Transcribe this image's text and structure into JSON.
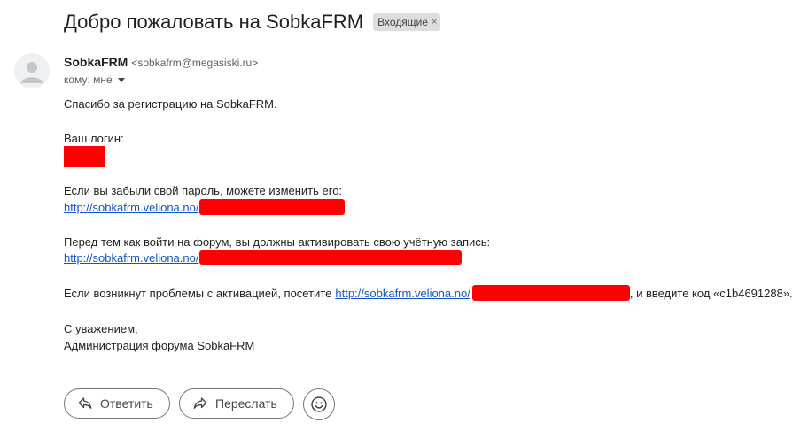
{
  "header": {
    "subject": "Добро пожаловать на SobkaFRM",
    "label": "Входящие",
    "label_remove": "×"
  },
  "sender": {
    "name": "SobkaFRM",
    "email": "<sobkafrm@megasiski.ru>",
    "to": "кому: мне"
  },
  "message": {
    "thanks": "Спасибо за регистрацию на SobkaFRM.",
    "login_label": "Ваш логин:",
    "forgot_text": "Если вы забыли свой пароль, можете изменить его:",
    "forgot_link": "http://sobkafrm.veliona.no/",
    "activate_text": "Перед тем как войти на форум, вы должны активировать свою учётную запись:",
    "activate_link": "http://sobkafrm.veliona.no/",
    "problems_text": "Если возникнут проблемы с активацией, посетите",
    "problems_link": "http://sobkafrm.veliona.no/",
    "problems_suffix": ", и введите код «c1b4691288».",
    "regards": "С уважением,",
    "signature": "Администрация форума SobkaFRM"
  },
  "actions": {
    "reply_label": "Ответить",
    "forward_label": "Переслать"
  },
  "colors": {
    "link": "#1155cc",
    "redaction": "#ff0000"
  }
}
